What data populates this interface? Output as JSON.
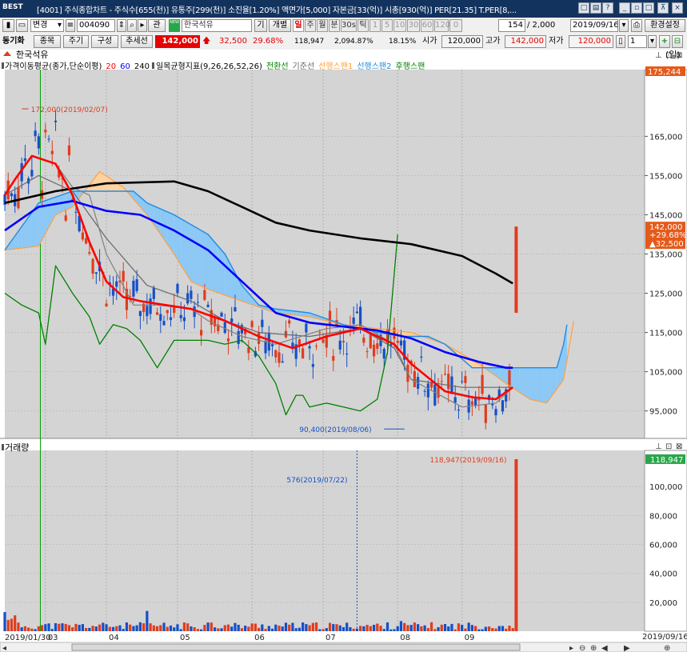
{
  "window": {
    "logo": "BEST",
    "title": "[4001] 주식종합차트 - 주식수[655(천)] 유통주[299(천)] 소진율[1.20%] 액면가[5,000] 자본금[33(억)] 시총[930(억)] PER[21.35] T.PER[8,..."
  },
  "toolbar1": {
    "change_label": "변경",
    "code": "004090",
    "gwan_label": "관",
    "new_badge": "NEW",
    "stock_name": "한국석유",
    "gi_label": "기",
    "gaebyeol_label": "개별",
    "periods": [
      {
        "label": "일",
        "state": "active"
      },
      {
        "label": "주",
        "state": "normal"
      },
      {
        "label": "월",
        "state": "normal"
      },
      {
        "label": "분",
        "state": "normal"
      },
      {
        "label": "30s",
        "state": "normal"
      },
      {
        "label": "틱",
        "state": "normal"
      },
      {
        "label": "1",
        "state": "dim"
      },
      {
        "label": "5",
        "state": "dim"
      },
      {
        "label": "10",
        "state": "dim"
      },
      {
        "label": "30",
        "state": "dim"
      },
      {
        "label": "60",
        "state": "dim"
      },
      {
        "label": "120",
        "state": "dim"
      },
      {
        "label": "0",
        "state": "dim"
      }
    ],
    "count": "154",
    "total": "/ 2,000",
    "date": "2019/09/16",
    "settings_label": "환경설정"
  },
  "toolbar2": {
    "sync_label": "동기화",
    "tabs": [
      "종목",
      "주기",
      "구성",
      "추세선"
    ],
    "price": "142,000",
    "change": "32,500",
    "change_pct": "29.68%",
    "volume": "118,947",
    "volume_pct": "2,094.87%",
    "turnover": "18.15%",
    "open_label": "시가",
    "open": "120,000",
    "high_label": "고가",
    "high": "142,000",
    "low_label": "저가",
    "low": "120,000",
    "qty": "1"
  },
  "colors": {
    "up": "#e03c1e",
    "down": "#1450c8",
    "panel_bg": "#d4d4d4",
    "ma20": "#ff0000",
    "ma60": "#0000ff",
    "ma240": "#000000",
    "conversion": "#808080",
    "base": "#696969",
    "lagging": "#008000",
    "span1": "#ffa040",
    "span2": "#1e8ce6",
    "cloud_up": "#ffd2a0",
    "cloud_down": "#8cc8f5"
  },
  "legend": {
    "stock_name": "한국석유",
    "period_label": "(일)",
    "ma_title": "가격이동평균(종가,단순이평)",
    "ma_periods": [
      "20",
      "60",
      "240"
    ],
    "ichimoku_title": "일목균형지표(9,26,26,52,26)",
    "conversion": "전환선",
    "base": "기준선",
    "span1": "선행스팬1",
    "span2": "선행스팬2",
    "lagging": "후행스팬",
    "volume_title": "거래량"
  },
  "chart_data": {
    "type": "candlestick",
    "period": "daily",
    "x_axis": {
      "start": "2019/01/30",
      "end": "2019/09/16",
      "month_labels": [
        "03",
        "04",
        "05",
        "06",
        "07",
        "08",
        "09"
      ]
    },
    "price_axis": {
      "ylim": [
        88000,
        182000
      ],
      "ticks": [
        "165,000",
        "155,000",
        "145,000",
        "135,000",
        "125,000",
        "115,000",
        "105,000",
        "95,000"
      ]
    },
    "volume_axis": {
      "ylim": [
        0,
        125000
      ],
      "ticks": [
        "100,000",
        "80,000",
        "60,000",
        "40,000",
        "20,000"
      ]
    },
    "annotations": {
      "high": "172,000(2019/02/07)",
      "low": "90,400(2019/08/06)",
      "volume_min": "576(2019/07/22)",
      "volume_max": "118,947(2019/09/16)"
    },
    "price_badges": {
      "top": "175,244",
      "last": "142,000",
      "last_pct": "+29.68%",
      "last_change": "▲32,500",
      "volume_last": "118,947"
    },
    "last_candle": {
      "date": "2019/09/16",
      "open": 120000,
      "high": 142000,
      "low": 120000,
      "close": 142000,
      "volume": 118947
    },
    "series": [
      {
        "name": "20",
        "points": [
          [
            0,
            150000
          ],
          [
            3,
            154000
          ],
          [
            8,
            160000
          ],
          [
            15,
            158000
          ],
          [
            20,
            150000
          ],
          [
            25,
            138000
          ],
          [
            30,
            128000
          ],
          [
            35,
            124000
          ],
          [
            40,
            123000
          ],
          [
            55,
            121000
          ],
          [
            65,
            118000
          ],
          [
            75,
            114000
          ],
          [
            85,
            111000
          ],
          [
            95,
            114000
          ],
          [
            105,
            116000
          ],
          [
            115,
            112000
          ],
          [
            120,
            107000
          ],
          [
            130,
            100000
          ],
          [
            138,
            98500
          ],
          [
            145,
            98000
          ],
          [
            150,
            101000
          ]
        ]
      },
      {
        "name": "60",
        "points": [
          [
            0,
            141000
          ],
          [
            10,
            147000
          ],
          [
            20,
            148500
          ],
          [
            30,
            146000
          ],
          [
            40,
            145000
          ],
          [
            50,
            141000
          ],
          [
            60,
            136000
          ],
          [
            70,
            128000
          ],
          [
            80,
            120000
          ],
          [
            90,
            117500
          ],
          [
            100,
            116500
          ],
          [
            110,
            115500
          ],
          [
            120,
            113500
          ],
          [
            130,
            110000
          ],
          [
            140,
            107500
          ],
          [
            148,
            106000
          ],
          [
            150,
            106000
          ]
        ]
      },
      {
        "name": "240",
        "points": [
          [
            0,
            148000
          ],
          [
            15,
            151000
          ],
          [
            30,
            153000
          ],
          [
            50,
            153500
          ],
          [
            60,
            151000
          ],
          [
            70,
            147000
          ],
          [
            80,
            143000
          ],
          [
            90,
            141000
          ],
          [
            105,
            139000
          ],
          [
            120,
            137500
          ],
          [
            135,
            134500
          ],
          [
            145,
            130000
          ],
          [
            150,
            127500
          ]
        ]
      },
      {
        "name": "전환선",
        "points": [
          [
            0,
            150000
          ],
          [
            8,
            160000
          ],
          [
            15,
            158000
          ],
          [
            20,
            152000
          ],
          [
            25,
            150000
          ],
          [
            30,
            135000
          ],
          [
            38,
            122000
          ],
          [
            45,
            122000
          ],
          [
            55,
            121000
          ],
          [
            60,
            118000
          ],
          [
            70,
            114000
          ],
          [
            80,
            112000
          ],
          [
            95,
            116000
          ],
          [
            105,
            117000
          ],
          [
            115,
            112000
          ],
          [
            120,
            103000
          ],
          [
            135,
            96000
          ],
          [
            145,
            97000
          ],
          [
            150,
            101000
          ]
        ]
      },
      {
        "name": "기준선",
        "points": [
          [
            0,
            150000
          ],
          [
            10,
            155000
          ],
          [
            20,
            151000
          ],
          [
            30,
            139000
          ],
          [
            42,
            127000
          ],
          [
            55,
            123000
          ],
          [
            65,
            118000
          ],
          [
            75,
            115000
          ],
          [
            90,
            114000
          ],
          [
            105,
            116000
          ],
          [
            115,
            111000
          ],
          [
            120,
            103000
          ],
          [
            135,
            101000
          ],
          [
            145,
            101000
          ],
          [
            150,
            101000
          ]
        ]
      },
      {
        "name": "후행스팬",
        "points": [
          [
            0,
            125000
          ],
          [
            5,
            122000
          ],
          [
            10,
            120000
          ],
          [
            12,
            112000
          ],
          [
            15,
            132000
          ],
          [
            20,
            125000
          ],
          [
            25,
            119000
          ],
          [
            28,
            112000
          ],
          [
            32,
            117000
          ],
          [
            36,
            116000
          ],
          [
            40,
            113000
          ],
          [
            45,
            106000
          ],
          [
            50,
            113000
          ],
          [
            55,
            113000
          ],
          [
            60,
            113000
          ],
          [
            65,
            112000
          ],
          [
            70,
            113000
          ],
          [
            75,
            109000
          ],
          [
            80,
            102000
          ],
          [
            83,
            94000
          ],
          [
            86,
            99000
          ],
          [
            88,
            99000
          ],
          [
            90,
            96000
          ],
          [
            95,
            97000
          ],
          [
            100,
            96000
          ],
          [
            105,
            95000
          ],
          [
            110,
            98000
          ],
          [
            113,
            110000
          ],
          [
            114,
            120000
          ],
          [
            116,
            140000
          ]
        ]
      },
      {
        "name": "선행스팬1",
        "points": [
          [
            0,
            136000
          ],
          [
            10,
            137000
          ],
          [
            15,
            145000
          ],
          [
            20,
            147000
          ],
          [
            28,
            156000
          ],
          [
            35,
            152000
          ],
          [
            42,
            145000
          ],
          [
            50,
            135000
          ],
          [
            55,
            128000
          ],
          [
            60,
            126000
          ],
          [
            70,
            123000
          ],
          [
            80,
            120000
          ],
          [
            90,
            119000
          ],
          [
            100,
            117000
          ],
          [
            110,
            116000
          ],
          [
            120,
            115000
          ],
          [
            130,
            112000
          ],
          [
            140,
            107000
          ],
          [
            148,
            102000
          ],
          [
            155,
            98000
          ],
          [
            160,
            97000
          ],
          [
            165,
            103000
          ],
          [
            168,
            118000
          ]
        ]
      },
      {
        "name": "선행스팬2",
        "points": [
          [
            0,
            136000
          ],
          [
            10,
            148000
          ],
          [
            20,
            151000
          ],
          [
            30,
            151000
          ],
          [
            38,
            151000
          ],
          [
            42,
            148000
          ],
          [
            50,
            145000
          ],
          [
            60,
            140000
          ],
          [
            65,
            135000
          ],
          [
            70,
            127000
          ],
          [
            75,
            122000
          ],
          [
            80,
            121000
          ],
          [
            90,
            120000
          ],
          [
            100,
            117000
          ],
          [
            110,
            115000
          ],
          [
            118,
            114000
          ],
          [
            125,
            114000
          ],
          [
            130,
            112000
          ],
          [
            138,
            106000
          ],
          [
            150,
            106000
          ],
          [
            160,
            106000
          ],
          [
            163,
            106000
          ],
          [
            165,
            112000
          ],
          [
            166,
            117000
          ]
        ]
      }
    ]
  },
  "scrollbar": {
    "end_date": "2019/09/16"
  }
}
